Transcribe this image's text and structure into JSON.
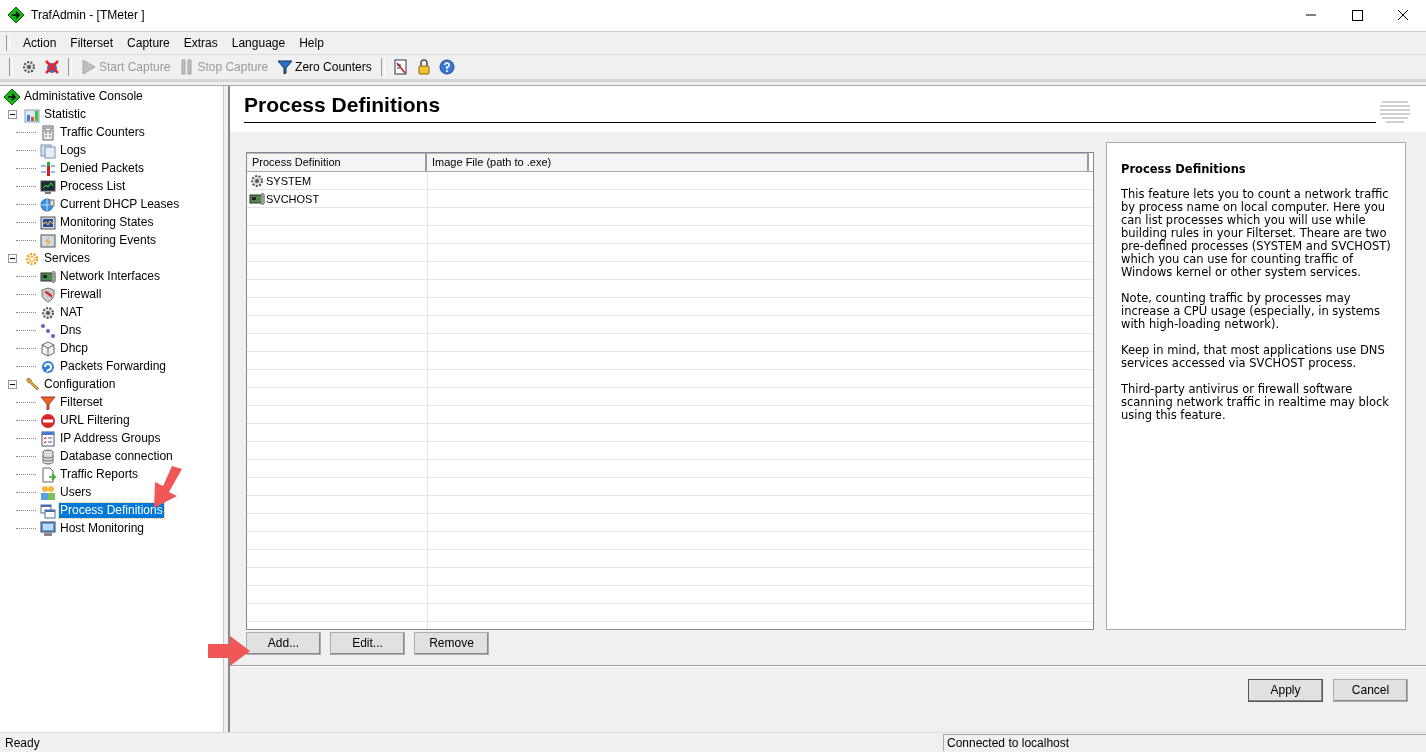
{
  "window": {
    "title": "TrafAdmin - [TMeter ]"
  },
  "menu": [
    "Action",
    "Filterset",
    "Capture",
    "Extras",
    "Language",
    "Help"
  ],
  "toolbar": [
    {
      "label": "Start Capture",
      "disabled": true
    },
    {
      "label": "Stop Capture",
      "disabled": true
    },
    {
      "label": "Zero Counters",
      "disabled": false
    }
  ],
  "tree": {
    "label": "Administative Console",
    "selected": false,
    "children": [
      {
        "label": "Statistic",
        "selected": false,
        "expanded": true,
        "children": [
          {
            "label": "Traffic Counters",
            "selected": false
          },
          {
            "label": "Logs",
            "selected": false
          },
          {
            "label": "Denied Packets",
            "selected": false
          },
          {
            "label": "Process List",
            "selected": false
          },
          {
            "label": "Current DHCP Leases",
            "selected": false
          },
          {
            "label": "Monitoring States",
            "selected": false
          },
          {
            "label": "Monitoring Events",
            "selected": false
          }
        ]
      },
      {
        "label": "Services",
        "selected": false,
        "expanded": true,
        "children": [
          {
            "label": "Network Interfaces",
            "selected": false
          },
          {
            "label": "Firewall",
            "selected": false
          },
          {
            "label": "NAT",
            "selected": false
          },
          {
            "label": "Dns",
            "selected": false
          },
          {
            "label": "Dhcp",
            "selected": false
          },
          {
            "label": "Packets Forwarding",
            "selected": false
          }
        ]
      },
      {
        "label": "Configuration",
        "selected": false,
        "expanded": true,
        "children": [
          {
            "label": "Filterset",
            "selected": false
          },
          {
            "label": "URL Filtering",
            "selected": false
          },
          {
            "label": "IP Address Groups",
            "selected": false
          },
          {
            "label": "Database connection",
            "selected": false
          },
          {
            "label": "Traffic Reports",
            "selected": false
          },
          {
            "label": "Users",
            "selected": false
          },
          {
            "label": "Process Definitions",
            "selected": true
          },
          {
            "label": "Host Monitoring",
            "selected": false
          }
        ]
      }
    ]
  },
  "page": {
    "title": "Process Definitions",
    "table": {
      "columns": [
        "Process Definition",
        "Image File (path to .exe)"
      ],
      "rows": [
        {
          "cells": [
            "SYSTEM"
          ]
        },
        {
          "cells": [
            "SVCHOST"
          ]
        }
      ]
    },
    "info": {
      "title": "Process Definitions",
      "paragraphs": [
        "This feature lets you to count a network traffic by process name on local computer. Here you can list processes which you will use while building rules in your Filterset. Theare are two pre-defined processes (SYSTEM and SVCHOST) which you can use for counting traffic of Windows kernel or other system services.",
        "Note, counting traffic by processes may increase a CPU usage (especially, in systems with high-loading network).",
        "Keep in mind, that most applications use DNS services accessed via SVCHOST process.",
        "Third-party antivirus or firewall software scanning network traffic in realtime may block using this feature."
      ]
    },
    "buttons": [
      "Add...",
      "Edit...",
      "Remove"
    ],
    "dialog_buttons": [
      "Apply",
      "Cancel"
    ]
  },
  "status_bar": {
    "message": "Ready",
    "connection": "Connected to localhost"
  }
}
